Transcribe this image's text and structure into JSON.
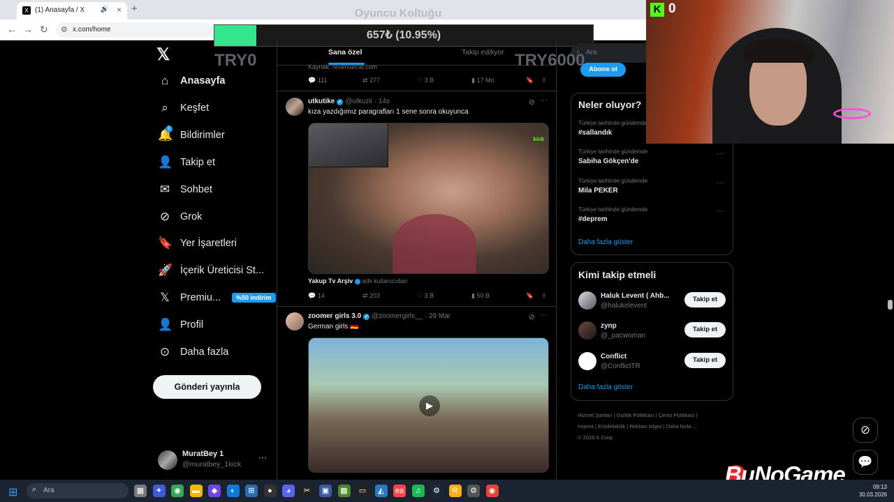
{
  "browser": {
    "tab_title": "(1) Anasayfa / X",
    "url": "x.com/home",
    "new_tab_symbol": "+"
  },
  "overlay": {
    "title": "Oyuncu Koltuğu",
    "progress_text": "657₺ (10.95%)",
    "progress_fraction": 0.1095,
    "left_label": "TRY0",
    "right_label": "TRY6000",
    "kick_count": "0"
  },
  "nav": {
    "items": [
      {
        "label": "Anasayfa",
        "icon": "home-icon"
      },
      {
        "label": "Keşfet",
        "icon": "search-icon"
      },
      {
        "label": "Bildirimler",
        "icon": "bell-icon",
        "badge": "1"
      },
      {
        "label": "Takip et",
        "icon": "add-person-icon"
      },
      {
        "label": "Sohbet",
        "icon": "mail-icon"
      },
      {
        "label": "Grok",
        "icon": "grok-icon"
      },
      {
        "label": "Yer İşaretleri",
        "icon": "bookmark-icon"
      },
      {
        "label": "İçerik Üreticisi St...",
        "icon": "rocket-icon"
      },
      {
        "label": "Premiu...",
        "icon": "x-icon",
        "promo": "%50 indirim"
      },
      {
        "label": "Profil",
        "icon": "person-icon"
      },
      {
        "label": "Daha fazla",
        "icon": "more-circle-icon"
      }
    ],
    "post_button": "Gönderi yayınla",
    "account": {
      "name": "MuratBey 1",
      "handle": "@muratbey_1kick"
    }
  },
  "feed": {
    "tabs": {
      "for_you": "Sana özel",
      "following": "Takip ediliyor"
    },
    "prev_post": {
      "source": "Kaynak: revenuecat.com",
      "replies": "111",
      "reposts": "277",
      "likes": "3 B",
      "views": "17 Mn"
    },
    "posts": [
      {
        "name": "utkutike",
        "handle": "@utkuzii",
        "time": "· 14s",
        "text": "kıza yazdığımız paragrafları 1 sene sonra okuyunca",
        "media_source": "Yakup Tv Arşiv",
        "media_source_suffix": "adlı kullanıcıdan",
        "media_tag": "kick",
        "replies": "14",
        "reposts": "203",
        "likes": "3 B",
        "views": "50 B"
      },
      {
        "name": "zoomer girls 3.0",
        "handle": "@zoomergirls__",
        "time": "· 29 Mar",
        "text": "German girls 🇩🇪"
      }
    ]
  },
  "right": {
    "search_placeholder": "Ara",
    "subscribe_label": "Abone ol",
    "trends_title": "Neler oluyor?",
    "trends": [
      {
        "context": "Türkiye tarihinde gündemde",
        "name": "#sallandık"
      },
      {
        "context": "Türkiye tarihinde gündemde",
        "name": "Sabiha Gökçen'de"
      },
      {
        "context": "Türkiye tarihinde gündemde",
        "name": "Mila PEKER"
      },
      {
        "context": "Türkiye tarihinde gündemde",
        "name": "#deprem"
      }
    ],
    "trends_more": "Daha fazla göster",
    "who_title": "Kimi takip etmeli",
    "who": [
      {
        "name": "Haluk Levent ( Ahb...",
        "handle": "@halukelevent",
        "button": "Takip et"
      },
      {
        "name": "zynp",
        "handle": "@_pacwoman",
        "button": "Takip et"
      },
      {
        "name": "Conflict",
        "handle": "@ConflictTR",
        "button": "Takip et"
      }
    ],
    "who_more": "Daha fazla göster",
    "footer": {
      "line1": "Hizmet Şartları  |  Gizlilik Politikası  |  Çerez Politikası  |",
      "line2": "Imprint  |  Erişilebilirlik  |  Reklam bilgisi  |  Daha fazla ...",
      "line3": "© 2026 X Corp."
    }
  },
  "watermark": "BuNoGame",
  "taskbar": {
    "search_placeholder": "Ara",
    "time": "09:13",
    "date": "30.03.2026"
  },
  "colors": {
    "accent": "#1d9bf0",
    "progress": "#33e58d",
    "kick": "#53fc18",
    "bg": "#000000"
  }
}
